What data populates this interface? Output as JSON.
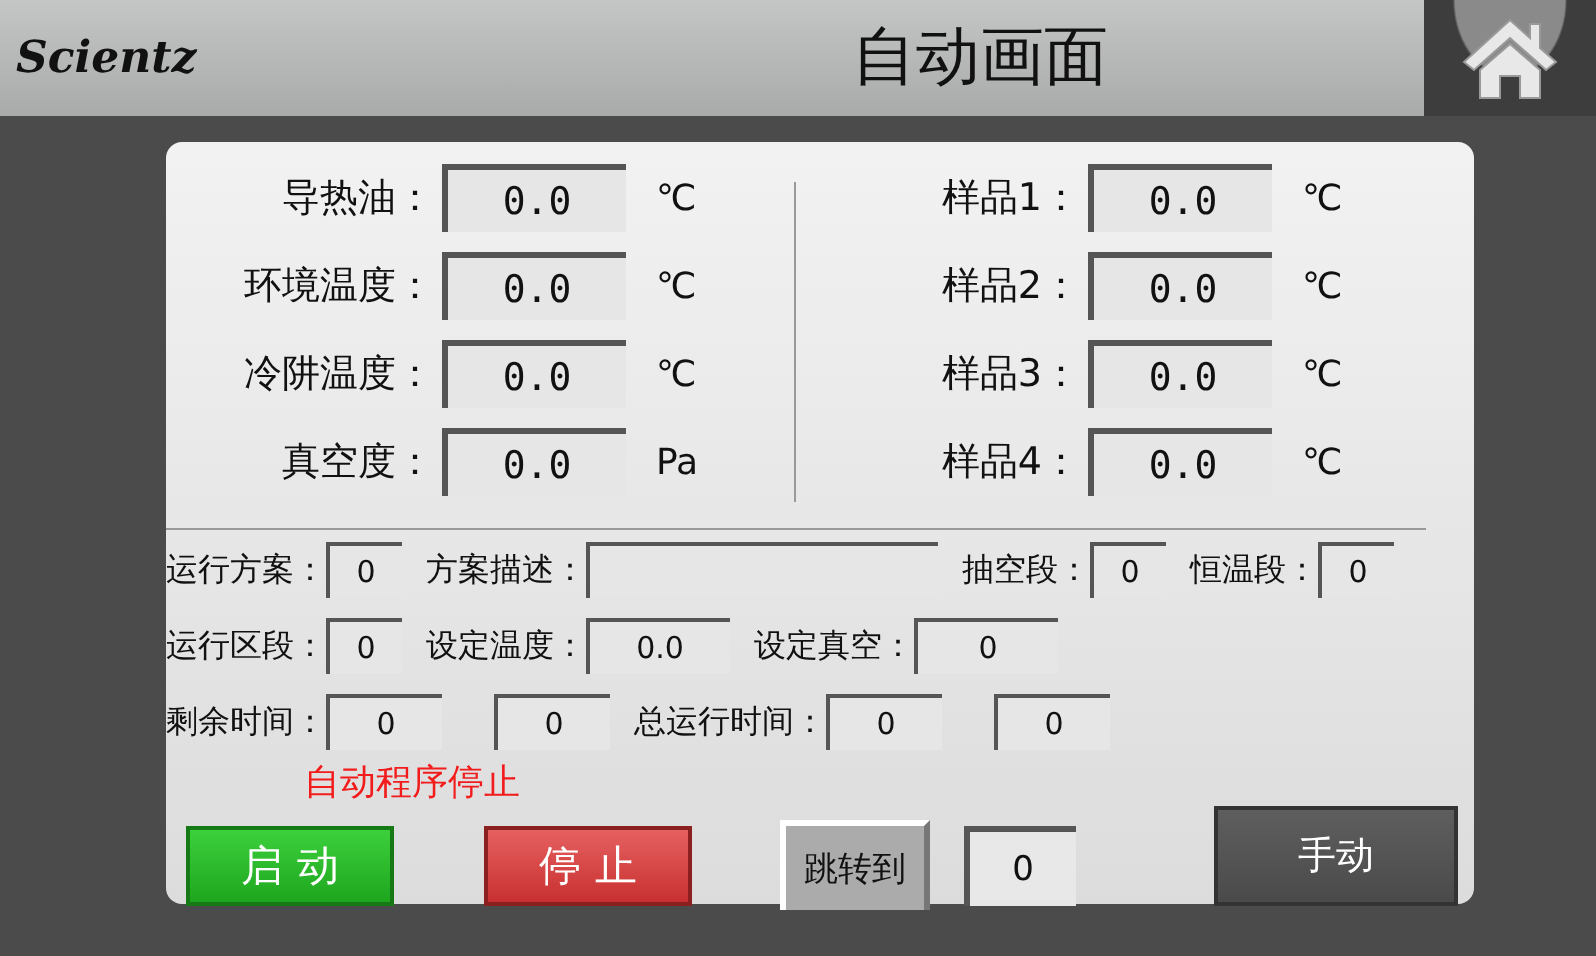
{
  "header": {
    "logo": "Scientz",
    "title": "自动画面"
  },
  "readings_left": [
    {
      "label": "导热油：",
      "value": "0.0",
      "unit": "℃"
    },
    {
      "label": "环境温度：",
      "value": "0.0",
      "unit": "℃"
    },
    {
      "label": "冷阱温度：",
      "value": "0.0",
      "unit": "℃"
    },
    {
      "label": "真空度：",
      "value": "0.0",
      "unit": "Pa"
    }
  ],
  "readings_right": [
    {
      "label": "样品1：",
      "value": "0.0",
      "unit": "℃"
    },
    {
      "label": "样品2：",
      "value": "0.0",
      "unit": "℃"
    },
    {
      "label": "样品3：",
      "value": "0.0",
      "unit": "℃"
    },
    {
      "label": "样品4：",
      "value": "0.0",
      "unit": "℃"
    }
  ],
  "params": [
    [
      {
        "label": "运行方案：",
        "value": "0",
        "kind": "narrow"
      },
      {
        "label": "方案描述：",
        "kind": "text"
      },
      {
        "label": "抽空段：",
        "value": "0",
        "kind": "narrow"
      },
      {
        "label": "恒温段：",
        "value": "0",
        "kind": "narrow"
      }
    ],
    [
      {
        "label": "运行区段：",
        "value": "0",
        "kind": "narrow"
      },
      {
        "label": "设定温度：",
        "value": "0.0",
        "kind": "wide"
      },
      {
        "label": "设定真空：",
        "value": "0",
        "kind": "wide"
      }
    ],
    [
      {
        "label": "剩余时间：",
        "value": "0",
        "kind": "medium"
      },
      {
        "value": "0",
        "kind": "medium"
      },
      {
        "label": "总运行时间：",
        "value": "0",
        "kind": "medium"
      },
      {
        "value": "0",
        "kind": "medium"
      }
    ]
  ],
  "status": "自动程序停止",
  "controls": [
    {
      "kind": "start",
      "label": "启 动"
    },
    {
      "kind": "stop",
      "label": "停 止"
    },
    {
      "kind": "jump",
      "label": "跳转到"
    },
    {
      "kind": "field",
      "value": "0"
    },
    {
      "kind": "manual",
      "label": "手动"
    }
  ]
}
